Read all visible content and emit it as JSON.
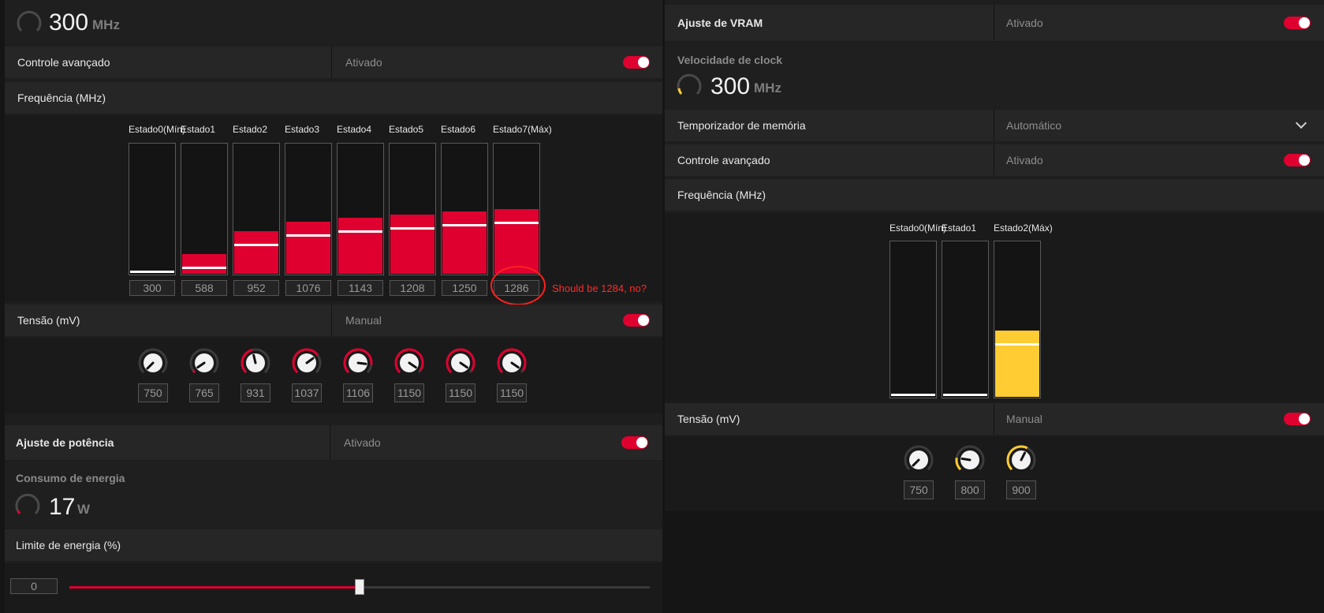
{
  "left": {
    "top_clock": {
      "value": "300",
      "unit": "MHz"
    },
    "advanced_control": {
      "label": "Controle avançado",
      "value": "Ativado"
    },
    "frequency": {
      "label": "Frequência (MHz)",
      "states": [
        {
          "name": "Estado0(Mín)",
          "value": "300",
          "level": 0.0
        },
        {
          "name": "Estado1",
          "value": "588",
          "level": 0.15
        },
        {
          "name": "Estado2",
          "value": "952",
          "level": 0.33
        },
        {
          "name": "Estado3",
          "value": "1076",
          "level": 0.4
        },
        {
          "name": "Estado4",
          "value": "1143",
          "level": 0.43
        },
        {
          "name": "Estado5",
          "value": "1208",
          "level": 0.46
        },
        {
          "name": "Estado6",
          "value": "1250",
          "level": 0.48
        },
        {
          "name": "Estado7(Máx)",
          "value": "1286",
          "level": 0.5
        }
      ],
      "annotation": "Should be 1284, no?"
    },
    "voltage": {
      "label": "Tensão (mV)",
      "value": "Manual",
      "knobs": [
        {
          "value": "750",
          "level": 0.0
        },
        {
          "value": "765",
          "level": 0.04
        },
        {
          "value": "931",
          "level": 0.45
        },
        {
          "value": "1037",
          "level": 0.7
        },
        {
          "value": "1106",
          "level": 0.86
        },
        {
          "value": "1150",
          "level": 0.96
        },
        {
          "value": "1150",
          "level": 0.96
        },
        {
          "value": "1150",
          "level": 0.96
        }
      ]
    },
    "power_tuning": {
      "label": "Ajuste de potência",
      "value": "Ativado"
    },
    "power_consumption": {
      "title": "Consumo de energia",
      "value": "17",
      "unit": "W"
    },
    "power_limit": {
      "label": "Limite de energia (%)",
      "value": "0",
      "slider_level": 0.5
    }
  },
  "right": {
    "vram_tuning": {
      "label": "Ajuste de VRAM",
      "value": "Ativado"
    },
    "clock_speed": {
      "title": "Velocidade de clock",
      "value": "300",
      "unit": "MHz"
    },
    "memory_timing": {
      "label": "Temporizador de memória",
      "value": "Automático"
    },
    "advanced_control": {
      "label": "Controle avançado",
      "value": "Ativado"
    },
    "frequency": {
      "label": "Frequência (MHz)",
      "states": [
        {
          "name": "Estado0(Mín)",
          "level": 0.0
        },
        {
          "name": "Estado1",
          "level": 0.0
        },
        {
          "name": "Estado2(Máx)",
          "level": 0.43
        }
      ]
    },
    "voltage": {
      "label": "Tensão (mV)",
      "value": "Manual",
      "knobs": [
        {
          "value": "750",
          "level": 0.0
        },
        {
          "value": "800",
          "level": 0.2
        },
        {
          "value": "900",
          "level": 0.6
        }
      ]
    }
  },
  "colors": {
    "accent": "#e00030",
    "vram_accent": "#ffcc33",
    "panel": "#1f1f1f",
    "row": "#262626",
    "annotation": "#ff2a2a"
  },
  "icons": {
    "clock_gauge": "gauge-icon",
    "dropdown": "chevron-down-icon"
  }
}
